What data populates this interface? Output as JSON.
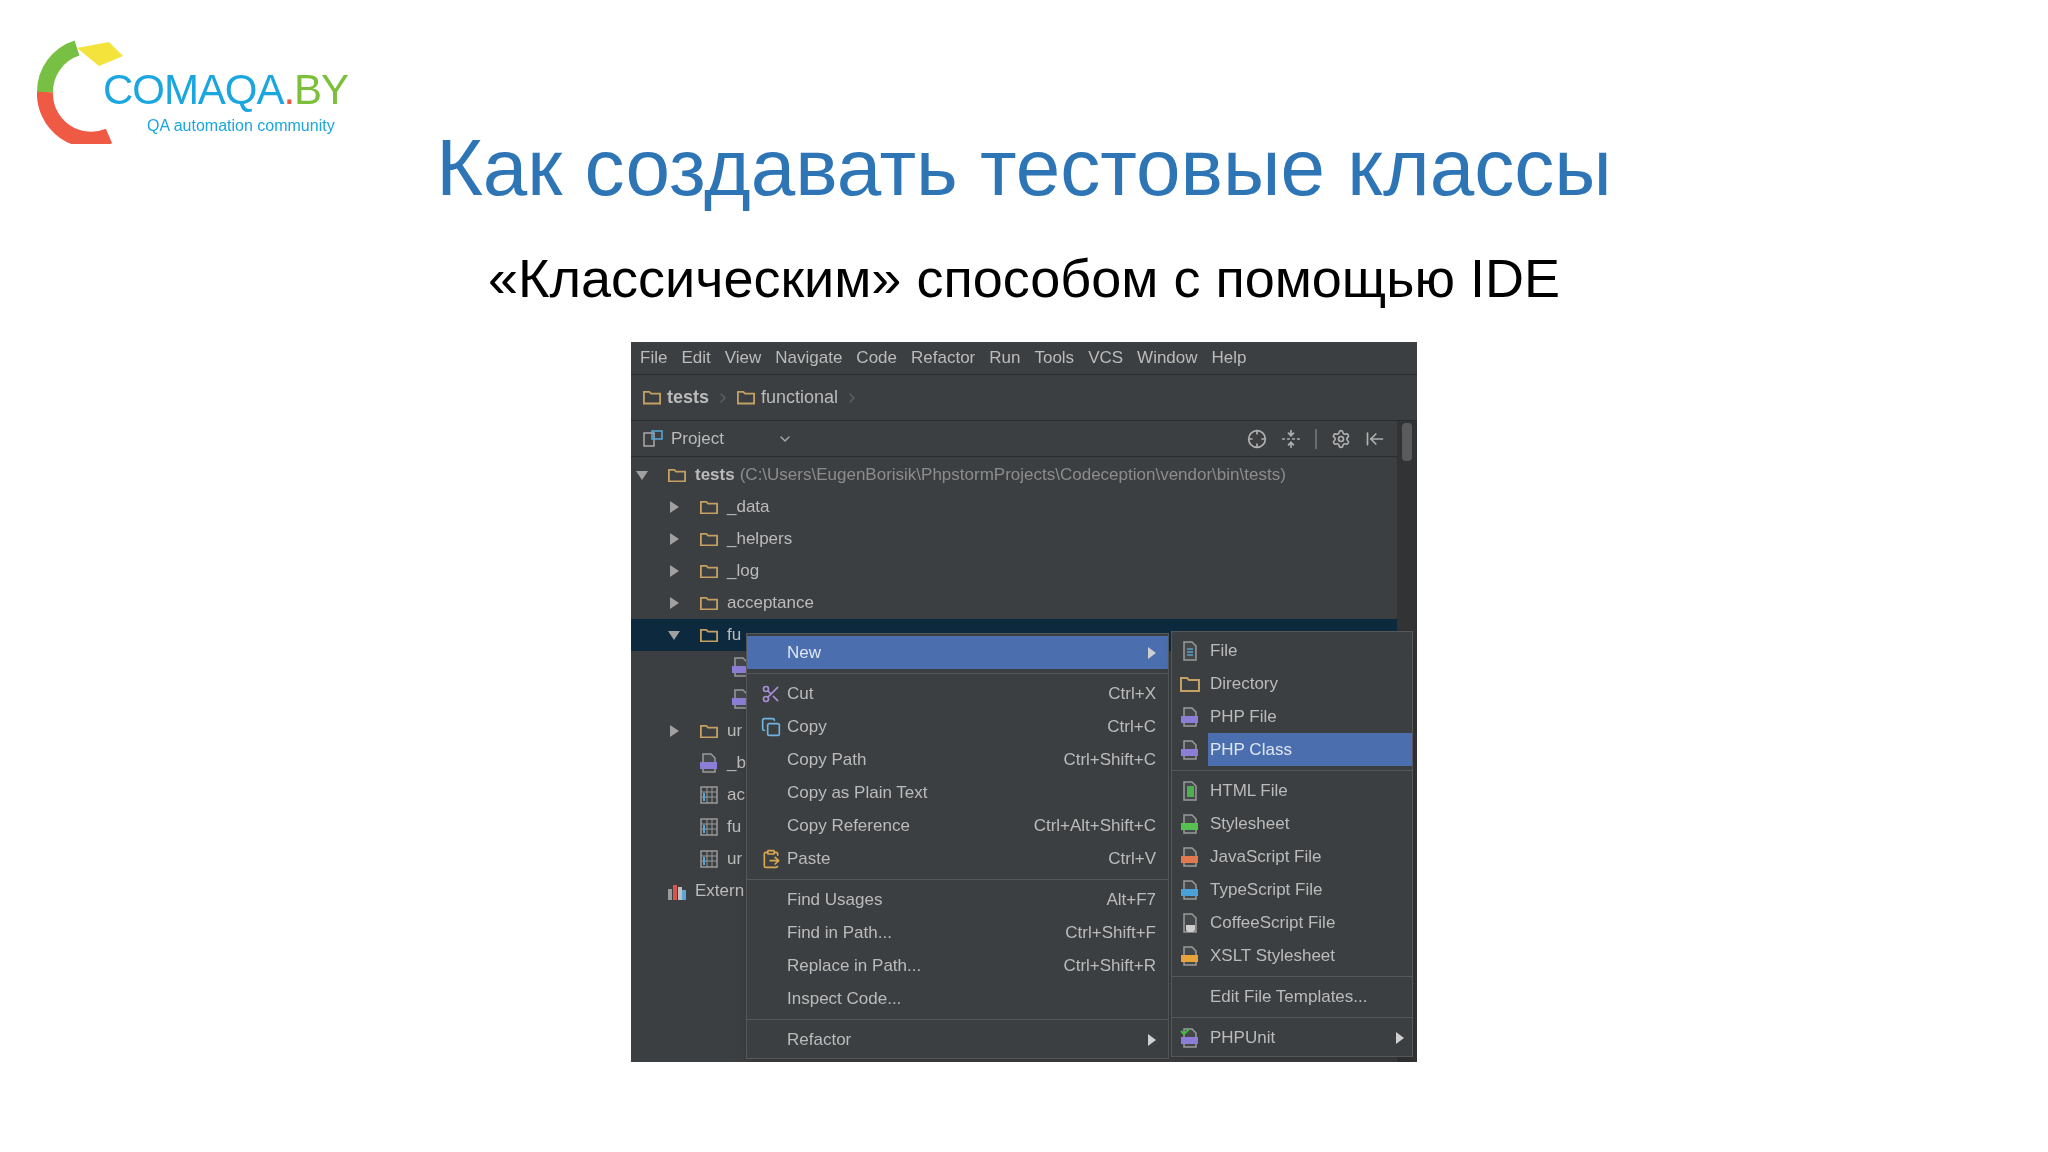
{
  "logo": {
    "name": "COMAQA",
    "dot": ".",
    "suffix": "BY",
    "tagline": "QA automation community"
  },
  "title": "Как создавать тестовые классы",
  "subtitle": "«Классическим» способом с помощью IDE",
  "ide": {
    "menu_bar": [
      "File",
      "Edit",
      "View",
      "Navigate",
      "Code",
      "Refactor",
      "Run",
      "Tools",
      "VCS",
      "Window",
      "Help"
    ],
    "breadcrumbs": [
      "tests",
      "functional"
    ],
    "project_panel": {
      "label": "Project"
    },
    "tree": [
      {
        "kind": "folder",
        "name": "tests",
        "path": "(C:\\Users\\EugenBorisik\\PhpstormProjects\\Codeception\\vendor\\bin\\tests)",
        "expanded": true,
        "selected": false,
        "children": [
          {
            "kind": "folder",
            "name": "_data",
            "expanded": false,
            "selected": false
          },
          {
            "kind": "folder",
            "name": "_helpers",
            "expanded": false,
            "selected": false
          },
          {
            "kind": "folder",
            "name": "_log",
            "expanded": false,
            "selected": false
          },
          {
            "kind": "folder",
            "name": "acceptance",
            "expanded": false,
            "selected": false
          },
          {
            "kind": "folder",
            "name": "fu",
            "expanded": true,
            "selected": true,
            "children": [
              {
                "kind": "php",
                "selected": false
              },
              {
                "kind": "php",
                "selected": false
              }
            ]
          },
          {
            "kind": "folder",
            "name": "ur",
            "expanded": false,
            "selected": false
          },
          {
            "kind": "php",
            "name": "_b",
            "selected": false
          },
          {
            "kind": "config",
            "name": "ac",
            "selected": false
          },
          {
            "kind": "config",
            "name": "fu",
            "selected": false
          },
          {
            "kind": "config",
            "name": "ur",
            "selected": false
          }
        ]
      },
      {
        "kind": "library",
        "name": "Extern",
        "selected": false
      }
    ],
    "context_menu": [
      {
        "kind": "plain",
        "label": "New",
        "submenu": true,
        "selected": true
      },
      {
        "kind": "separator"
      },
      {
        "kind": "cut",
        "label": "Cut",
        "shortcut": "Ctrl+X",
        "submenu": false,
        "selected": false
      },
      {
        "kind": "copy",
        "label": "Copy",
        "shortcut": "Ctrl+C",
        "submenu": false,
        "selected": false
      },
      {
        "kind": "plain",
        "label": "Copy Path",
        "shortcut": "Ctrl+Shift+C",
        "submenu": false,
        "selected": false
      },
      {
        "kind": "plain",
        "label": "Copy as Plain Text",
        "submenu": false,
        "selected": false
      },
      {
        "kind": "plain",
        "label": "Copy Reference",
        "shortcut": "Ctrl+Alt+Shift+C",
        "submenu": false,
        "selected": false
      },
      {
        "kind": "paste",
        "label": "Paste",
        "shortcut": "Ctrl+V",
        "submenu": false,
        "selected": false
      },
      {
        "kind": "separator"
      },
      {
        "kind": "plain",
        "label": "Find Usages",
        "shortcut": "Alt+F7",
        "submenu": false,
        "selected": false
      },
      {
        "kind": "plain",
        "label": "Find in Path...",
        "shortcut": "Ctrl+Shift+F",
        "submenu": false,
        "selected": false
      },
      {
        "kind": "plain",
        "label": "Replace in Path...",
        "shortcut": "Ctrl+Shift+R",
        "submenu": false,
        "selected": false
      },
      {
        "kind": "plain",
        "label": "Inspect Code...",
        "submenu": false,
        "selected": false
      },
      {
        "kind": "separator"
      },
      {
        "kind": "plain",
        "label": "Refactor",
        "submenu": true,
        "selected": false
      }
    ],
    "new_submenu": [
      {
        "kind": "file",
        "label": "File",
        "submenu": false,
        "selected": false
      },
      {
        "kind": "folder",
        "label": "Directory",
        "submenu": false,
        "selected": false
      },
      {
        "kind": "php",
        "label": "PHP File",
        "submenu": false,
        "selected": false
      },
      {
        "kind": "php",
        "label": "PHP Class",
        "submenu": false,
        "selected": true
      },
      {
        "kind": "separator"
      },
      {
        "kind": "html",
        "label": "HTML File",
        "submenu": false,
        "selected": false
      },
      {
        "kind": "css",
        "label": "Stylesheet",
        "submenu": false,
        "selected": false
      },
      {
        "kind": "js",
        "label": "JavaScript File",
        "submenu": false,
        "selected": false
      },
      {
        "kind": "ts",
        "label": "TypeScript File",
        "submenu": false,
        "selected": false
      },
      {
        "kind": "coffee",
        "label": "CoffeeScript File",
        "submenu": false,
        "selected": false
      },
      {
        "kind": "xslt",
        "label": "XSLT Stylesheet",
        "submenu": false,
        "selected": false
      },
      {
        "kind": "separator"
      },
      {
        "kind": "plain",
        "label": "Edit File Templates...",
        "submenu": false,
        "selected": false
      },
      {
        "kind": "separator"
      },
      {
        "kind": "phpunit",
        "label": "PHPUnit",
        "submenu": true,
        "selected": false
      }
    ]
  }
}
